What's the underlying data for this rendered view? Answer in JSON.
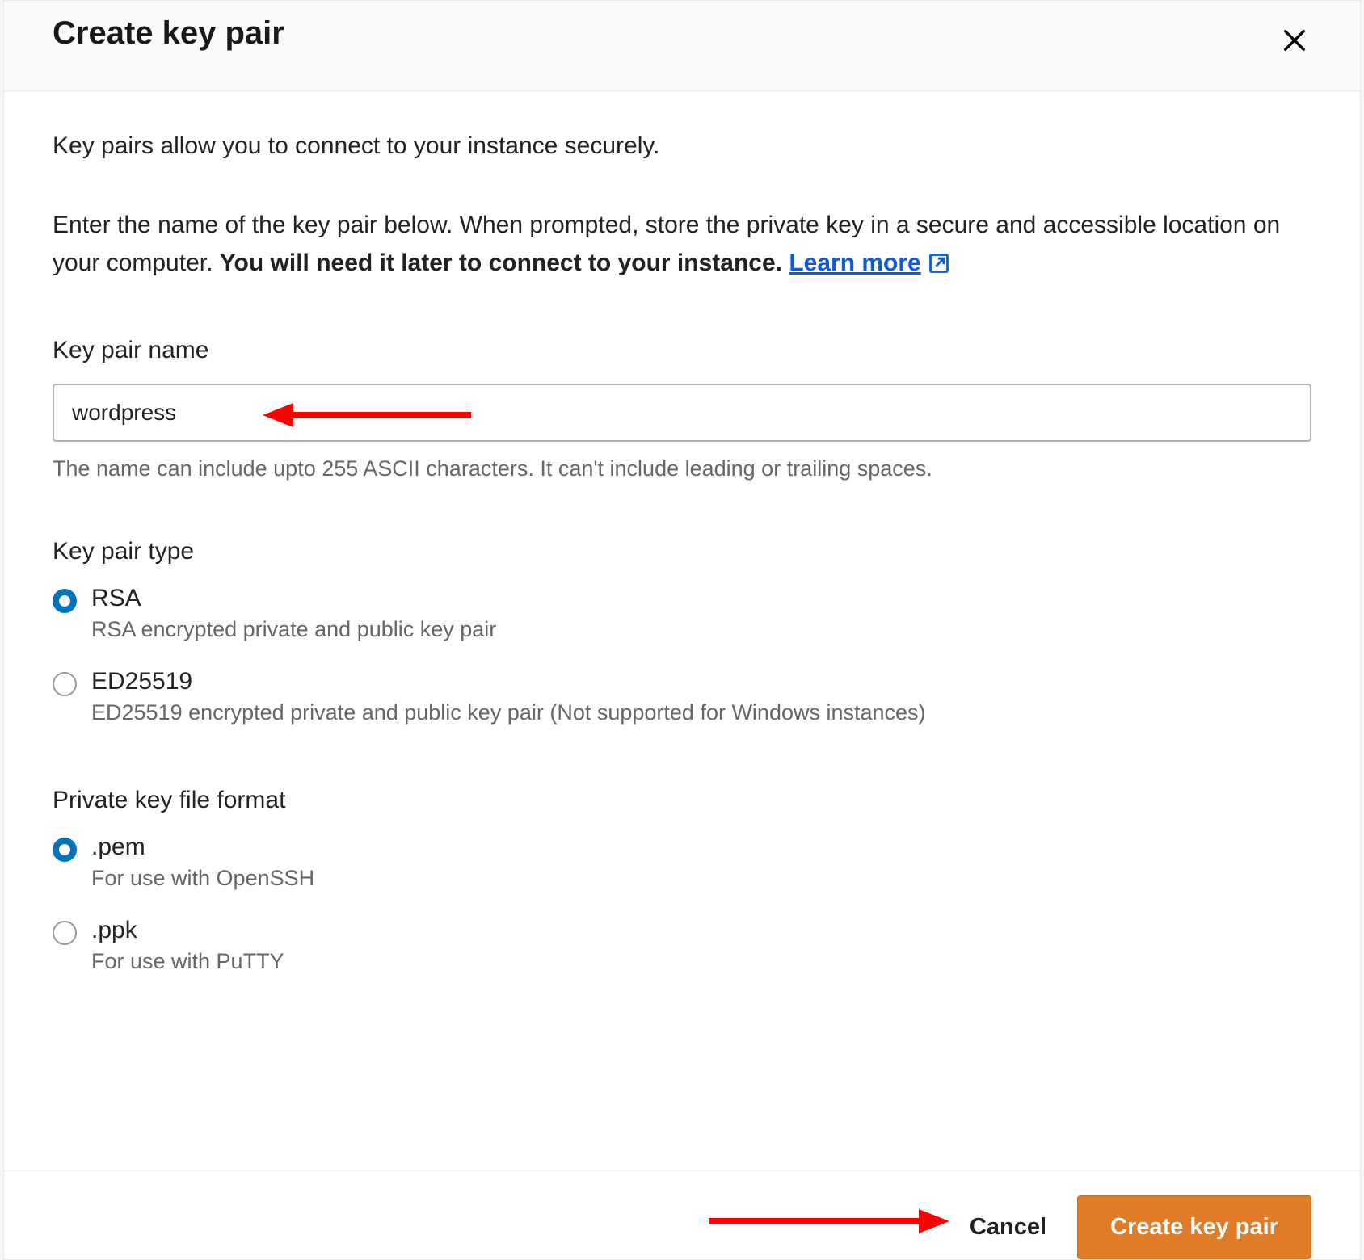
{
  "modal": {
    "title": "Create key pair",
    "intro1": "Key pairs allow you to connect to your instance securely.",
    "intro2_a": "Enter the name of the key pair below. When prompted, store the private key in a secure and accessible location on your computer. ",
    "intro2_b": "You will need it later to connect to your instance.",
    "learn_more": "Learn more",
    "name_field": {
      "label": "Key pair name",
      "value": "wordpress",
      "help": "The name can include upto 255 ASCII characters. It can't include leading or trailing spaces."
    },
    "type_section": {
      "label": "Key pair type",
      "options": [
        {
          "title": "RSA",
          "desc": "RSA encrypted private and public key pair",
          "selected": true
        },
        {
          "title": "ED25519",
          "desc": "ED25519 encrypted private and public key pair (Not supported for Windows instances)",
          "selected": false
        }
      ]
    },
    "format_section": {
      "label": "Private key file format",
      "options": [
        {
          "title": ".pem",
          "desc": "For use with OpenSSH",
          "selected": true
        },
        {
          "title": ".ppk",
          "desc": "For use with PuTTY",
          "selected": false
        }
      ]
    },
    "footer": {
      "cancel": "Cancel",
      "primary": "Create key pair"
    }
  }
}
